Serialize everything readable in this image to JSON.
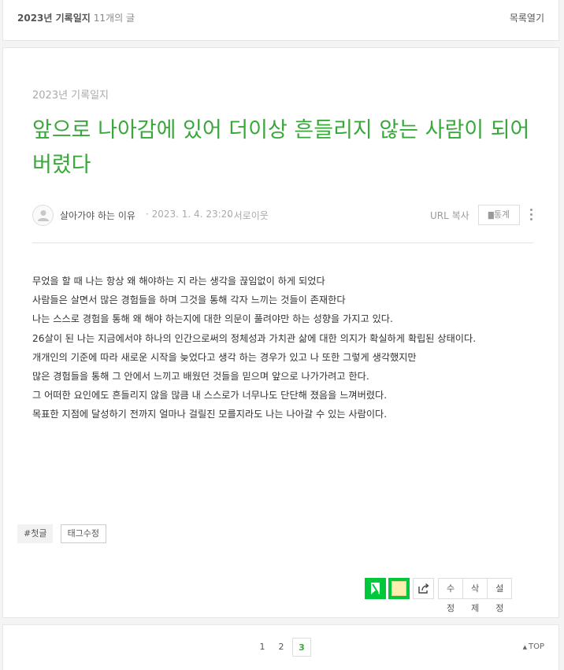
{
  "topbar": {
    "category": "2023년 기록일지",
    "post_count": "11개의 글",
    "open_list": "목록열기"
  },
  "post": {
    "category": "2023년 기록일지",
    "title": "앞으로 나아감에 있어 더이상 흔들리지 않는 사람이 되어 버렸다",
    "author": "살아가야 하는 이유",
    "date": "· 2023. 1. 4. 23:20",
    "visibility": "· 서로이웃",
    "url_copy": "URL 복사",
    "stats": "통계",
    "body": [
      "무었을 할 때 나는 항상 왜 해야하는 지 라는 생각을 끊임없이 하게 되었다",
      "사람들은 살면서 많은 경험들을 하며 그것을 통해 각자 느끼는 것들이 존재한다",
      "나는 스스로 경험을 통해 왜 해야 하는지에 대한 의문이 풀려야만 하는 성향을 가지고 있다.",
      "26살이 된 나는  지금에서야 하나의 인간으로써의 정체성과 가치관 삶에 대한 의지가 확실하게 확립된 상태이다.",
      "개개인의 기준에 따라 새로운 시작을 늦었다고 생각 하는 경우가 있고 나 또한 그렇게 생각했지만",
      "많은 경험들을 통해 그 안에서 느끼고 배웠던 것들을 믿으며 앞으로 나가가려고 한다.",
      "그 어떠한 요인에도 흔들리지 않을 많큼 내 스스로가 너무나도 단단해 졌음을 느껴버렸다.",
      "목표한 지점에 달성하기 전까지 얼마나 걸릴진 모를지라도 나는 나아갈 수 있는 사람이다."
    ],
    "tags": [
      "#첫글"
    ],
    "tag_edit": "태그수정",
    "actions": {
      "edit": "수정",
      "delete": "삭제",
      "settings": "설정"
    }
  },
  "footer": {
    "pages": [
      "1",
      "2",
      "3"
    ],
    "current_page": "3",
    "top": "TOP"
  },
  "colors": {
    "accent_green": "#39a83b",
    "naver_green": "#00c73c"
  }
}
